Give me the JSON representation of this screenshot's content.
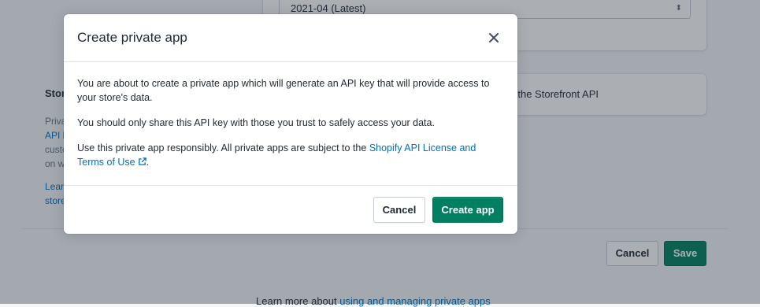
{
  "background": {
    "api_version_value": "2021-04 (Latest)",
    "storefront_section_title": "Stor",
    "storefront_text_lines": [
      "Priva",
      "API k",
      "custo",
      "on w"
    ],
    "storefront_link_lines": [
      "Learn",
      "store"
    ],
    "storefront_checkbox_label": "the Storefront API",
    "cancel_label": "Cancel",
    "save_label": "Save",
    "learn_more_prefix": "Learn more about",
    "learn_more_link": "using and managing private apps"
  },
  "modal": {
    "title": "Create private app",
    "paragraph_1": "You are about to create a private app which will generate an API key that will provide access to your store's data.",
    "paragraph_2": "You should only share this API key with those you trust to safely access your data.",
    "paragraph_3_prefix": "Use this private app responsibly. All private apps are subject to the ",
    "paragraph_3_link": "Shopify API License and Terms of Use",
    "paragraph_3_suffix": ".",
    "cancel_label": "Cancel",
    "create_label": "Create app"
  },
  "icons": {
    "close": "close-icon",
    "external_link": "external-link-icon",
    "select_caret": "select-caret-icon"
  },
  "colors": {
    "primary_green": "#008060",
    "link_blue": "#006fbb",
    "overlay": "rgba(33,43,54,0.38)"
  }
}
